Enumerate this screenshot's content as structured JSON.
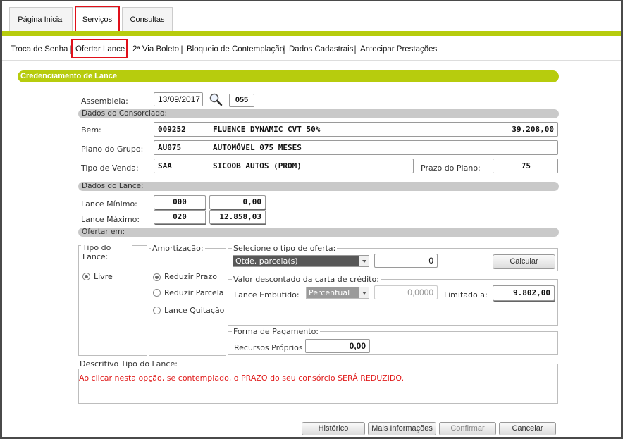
{
  "tabs": [
    {
      "label": "Página Inicial"
    },
    {
      "label": "Serviços"
    },
    {
      "label": "Consultas"
    }
  ],
  "subnav": [
    "Troca de Senha",
    "Ofertar Lance",
    "2ª Via Boleto",
    "Bloqueio de Contemplação",
    "Dados Cadastrais",
    "Antecipar Prestações"
  ],
  "title": "Credenciamento de Lance",
  "assembleia": {
    "label": "Assembleia:",
    "date": "13/09/2017",
    "number": "055"
  },
  "consorciado": {
    "section": "Dados do Consorciado:",
    "bem_label": "Bem:",
    "bem_code": "009252",
    "bem_desc": "FLUENCE DYNAMIC CVT 50%",
    "bem_value": "39.208,00",
    "plano_label": "Plano do Grupo:",
    "plano_code": "AU075",
    "plano_desc": "AUTOMÓVEL 075 MESES",
    "venda_label": "Tipo de Venda:",
    "venda_code": "SAA",
    "venda_desc": "SICOOB AUTOS (PROM)",
    "prazo_label": "Prazo do Plano:",
    "prazo_value": "75"
  },
  "lance": {
    "section": "Dados do Lance:",
    "min_label": "Lance Mínimo:",
    "min_code": "000",
    "min_value": "0,00",
    "max_label": "Lance Máximo:",
    "max_code": "020",
    "max_value": "12.858,03"
  },
  "ofertar": {
    "section": "Ofertar em:",
    "tipo_legend": "Tipo do Lance:",
    "tipo_option": "Livre",
    "amort_legend": "Amortização:",
    "amort_options": [
      "Reduzir Prazo",
      "Reduzir Parcela",
      "Lance Quitação"
    ],
    "oferta_legend": "Selecione o tipo de oferta:",
    "oferta_select": "Qtde. parcela(s)",
    "oferta_value": "0",
    "calcular": "Calcular",
    "valor_legend": "Valor descontado da carta de crédito:",
    "embutido_label": "Lance Embutido:",
    "embutido_select": "Percentual",
    "embutido_value": "0,0000",
    "limitado_label": "Limitado a:",
    "limitado_value": "9.802,00",
    "pagamento_legend": "Forma de Pagamento:",
    "recursos_label": "Recursos Próprios",
    "recursos_value": "0,00"
  },
  "descritivo": {
    "legend": "Descritivo Tipo do Lance:",
    "text": "Ao clicar nesta opção, se contemplado, o PRAZO do seu consórcio SERÁ REDUZIDO."
  },
  "buttons": {
    "historico": "Histórico",
    "info": "Mais Informações",
    "confirmar": "Confirmar",
    "cancelar": "Cancelar"
  },
  "colors": {
    "accent": "#b7cc0d",
    "highlight": "#e0101a",
    "warning": "#e01b1b"
  }
}
